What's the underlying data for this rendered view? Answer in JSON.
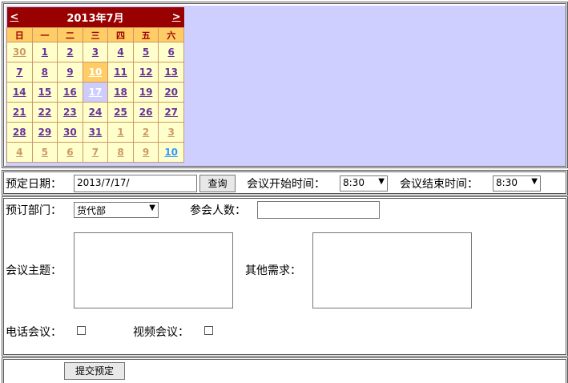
{
  "calendar": {
    "title": "2013年7月",
    "prev": "<",
    "next": ">",
    "weekdays": [
      "日",
      "一",
      "二",
      "三",
      "四",
      "五",
      "六"
    ],
    "weeks": [
      [
        "30",
        "1",
        "2",
        "3",
        "4",
        "5",
        "6"
      ],
      [
        "7",
        "8",
        "9",
        "10",
        "11",
        "12",
        "13"
      ],
      [
        "14",
        "15",
        "16",
        "17",
        "18",
        "19",
        "20"
      ],
      [
        "21",
        "22",
        "23",
        "24",
        "25",
        "26",
        "27"
      ],
      [
        "28",
        "29",
        "30",
        "31",
        "1",
        "2",
        "3"
      ],
      [
        "4",
        "5",
        "6",
        "7",
        "8",
        "9",
        "10"
      ]
    ]
  },
  "booking": {
    "date_label": "预定日期：",
    "date_value": "2013/7/17/",
    "query_button": "查询",
    "start_label": "会议开始时间：",
    "start_value": "8:30",
    "end_label": "会议结束时间：",
    "end_value": "8:30"
  },
  "form": {
    "dept_label": "预订部门：",
    "dept_value": "货代部",
    "attendees_label": "参会人数：",
    "attendees_value": "",
    "topic_label": "会议主题：",
    "other_label": "其他需求：",
    "phone_label": "电话会议：",
    "video_label": "视频会议："
  },
  "submit_button": "提交预定",
  "colors": {
    "calendar_header": "#990000",
    "weekday_bg": "#ffcc66",
    "day_bg": "#ffffcc",
    "selected_bg": "#ccccff",
    "panel_bg": "#cfcfff"
  }
}
